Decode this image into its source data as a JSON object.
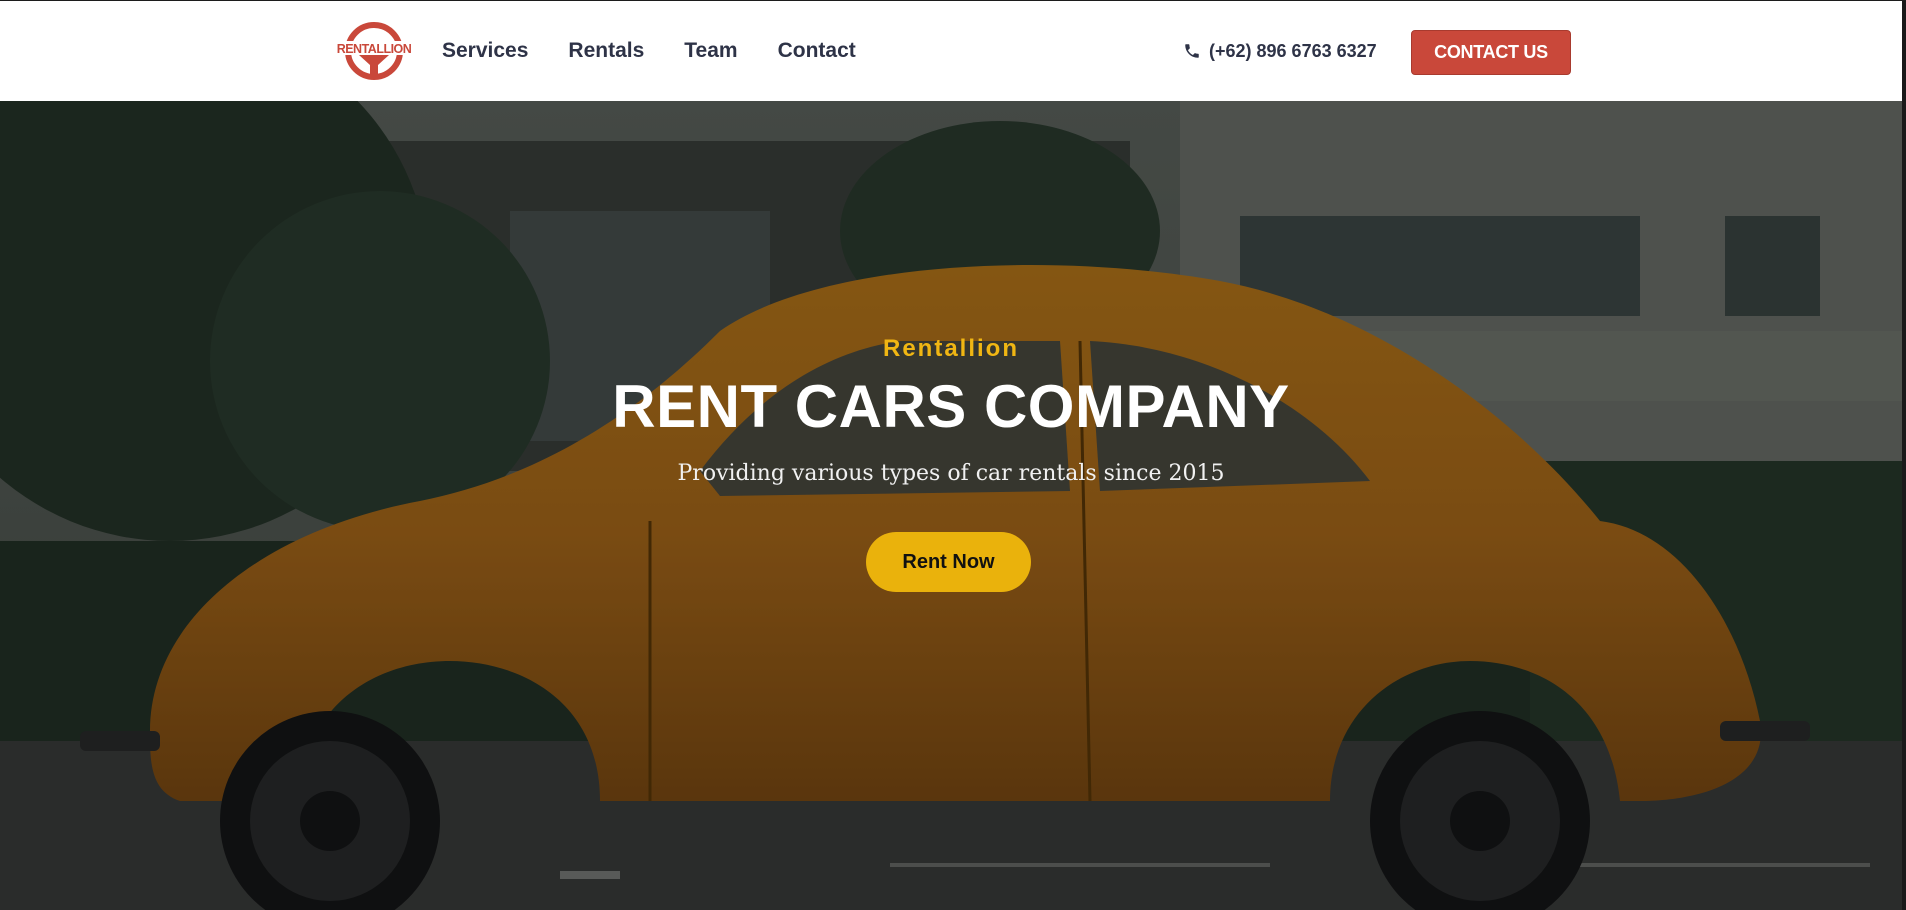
{
  "brand": {
    "name": "RENTALLION",
    "logo_color": "#c9483a"
  },
  "nav": {
    "links": [
      {
        "label": "Services"
      },
      {
        "label": "Rentals"
      },
      {
        "label": "Team"
      },
      {
        "label": "Contact"
      }
    ],
    "phone": "(+62) 896 6763 6327",
    "phone_icon": "phone-icon",
    "cta_label": "CONTACT US",
    "cta_color": "#c9483a"
  },
  "hero": {
    "eyebrow": "Rentallion",
    "title": "RENT CARS COMPANY",
    "subtitle": "Providing various types of car rentals since 2015",
    "button_label": "Rent Now",
    "accent_color": "#eab20c"
  }
}
